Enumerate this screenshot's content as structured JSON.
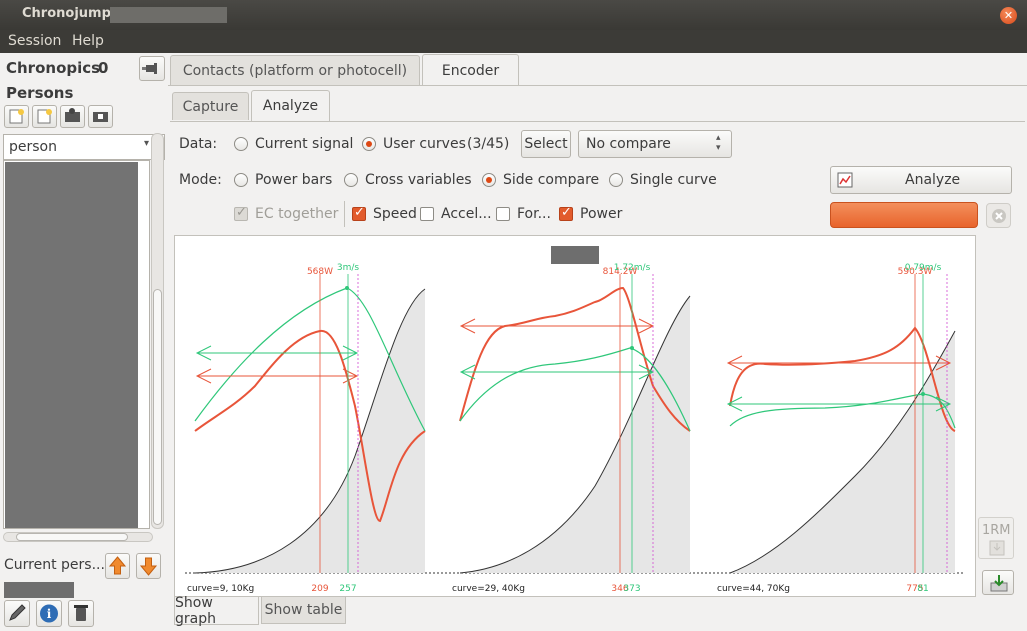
{
  "window": {
    "title": "Chronojump –"
  },
  "menu": [
    "Session",
    "Help"
  ],
  "left": {
    "chronopics_label": "Chronopics",
    "chronopics_count": "0",
    "persons_label": "Persons",
    "person_combo": "person",
    "current_person_label": "Current pers..."
  },
  "tabs": {
    "contacts": "Contacts (platform or photocell)",
    "encoder": "Encoder"
  },
  "subtabs": {
    "capture": "Capture",
    "analyze": "Analyze"
  },
  "data_row": {
    "label": "Data:",
    "current_signal": "Current signal",
    "user_curves": "User curves",
    "user_curves_count": "(3/45)",
    "select_button": "Select",
    "compare_combo": "No compare"
  },
  "mode_row": {
    "label": "Mode:",
    "power_bars": "Power bars",
    "cross_variables": "Cross variables",
    "side_compare": "Side compare",
    "single_curve": "Single curve",
    "analyze_button": "Analyze"
  },
  "checks_row": {
    "ec_together": "EC together",
    "speed": "Speed",
    "accel": "Accel...",
    "force": "For...",
    "power": "Power"
  },
  "graph": {
    "panels": [
      {
        "caption": "curve=9, 10Kg",
        "power_label": "568W",
        "speed_label": "3m/s",
        "x_power": "209",
        "x_speed": "257"
      },
      {
        "caption": "curve=29, 40Kg",
        "power_label": "814.2W",
        "speed_label": "1.72m/s",
        "x_power": "346",
        "x_speed": "373"
      },
      {
        "caption": "curve=44, 70Kg",
        "power_label": "590.3W",
        "speed_label": "0.79m/s",
        "x_power": "775",
        "x_speed": "81"
      }
    ]
  },
  "right_side": {
    "one_rm": "1RM"
  },
  "bottom_tabs": {
    "show_graph": "Show graph",
    "show_table": "Show table"
  },
  "colors": {
    "accent": "#dd4814",
    "power": "#e8553a",
    "speed": "#2fc77a",
    "progress": "#f07c45"
  }
}
